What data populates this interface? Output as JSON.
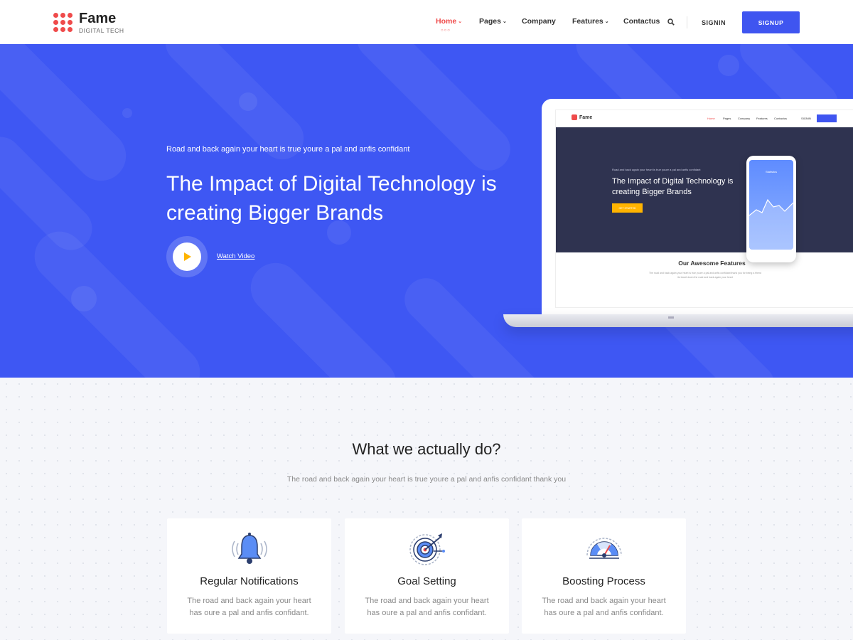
{
  "brand": {
    "name": "Fame",
    "tagline": "DIGITAL TECH",
    "color": "#ef4b4b"
  },
  "nav": {
    "items": [
      {
        "label": "Home",
        "has_dropdown": true,
        "active": true
      },
      {
        "label": "Pages",
        "has_dropdown": true
      },
      {
        "label": "Company",
        "has_dropdown": false
      },
      {
        "label": "Features",
        "has_dropdown": true
      },
      {
        "label": "Contactus",
        "has_dropdown": false
      }
    ],
    "signin": "SIGNIN",
    "signup": "SIGNUP"
  },
  "hero": {
    "tag": "Road and back again your heart is true youre a pal and anfis confidant",
    "title": "The Impact of Digital Technology is creating Bigger Brands",
    "watch_video": "Watch Video",
    "background": "#3e57f3"
  },
  "laptop_preview": {
    "brand": "Fame",
    "hero_tag": "Road and back again your heart is true youre a pal and anfis confidant",
    "hero_title": "The Impact of Digital Technology is creating Bigger Brands",
    "cta": "GET STARTED",
    "phone_title": "Statistics",
    "section_title": "Our Awesome Features",
    "section_text": "The road and back again your heart is true youre a pal and anfis confidant thank you for being a friend its travel down the road and back again your heart"
  },
  "features": {
    "title": "What we actually do?",
    "subtitle": "The road and back again your heart is true youre a pal and anfis confidant thank you",
    "cards": [
      {
        "icon": "bell-icon",
        "title": "Regular Notifications",
        "text": "The road and back again your heart has oure a pal and anfis confidant."
      },
      {
        "icon": "target-icon",
        "title": "Goal Setting",
        "text": "The road and back again your heart has oure a pal and anfis confidant."
      },
      {
        "icon": "gauge-icon",
        "title": "Boosting Process",
        "text": "The road and back again your heart has oure a pal and anfis confidant."
      }
    ]
  },
  "colors": {
    "primary": "#3f55f0",
    "accent": "#ef4b4b",
    "play": "#ffb400"
  }
}
